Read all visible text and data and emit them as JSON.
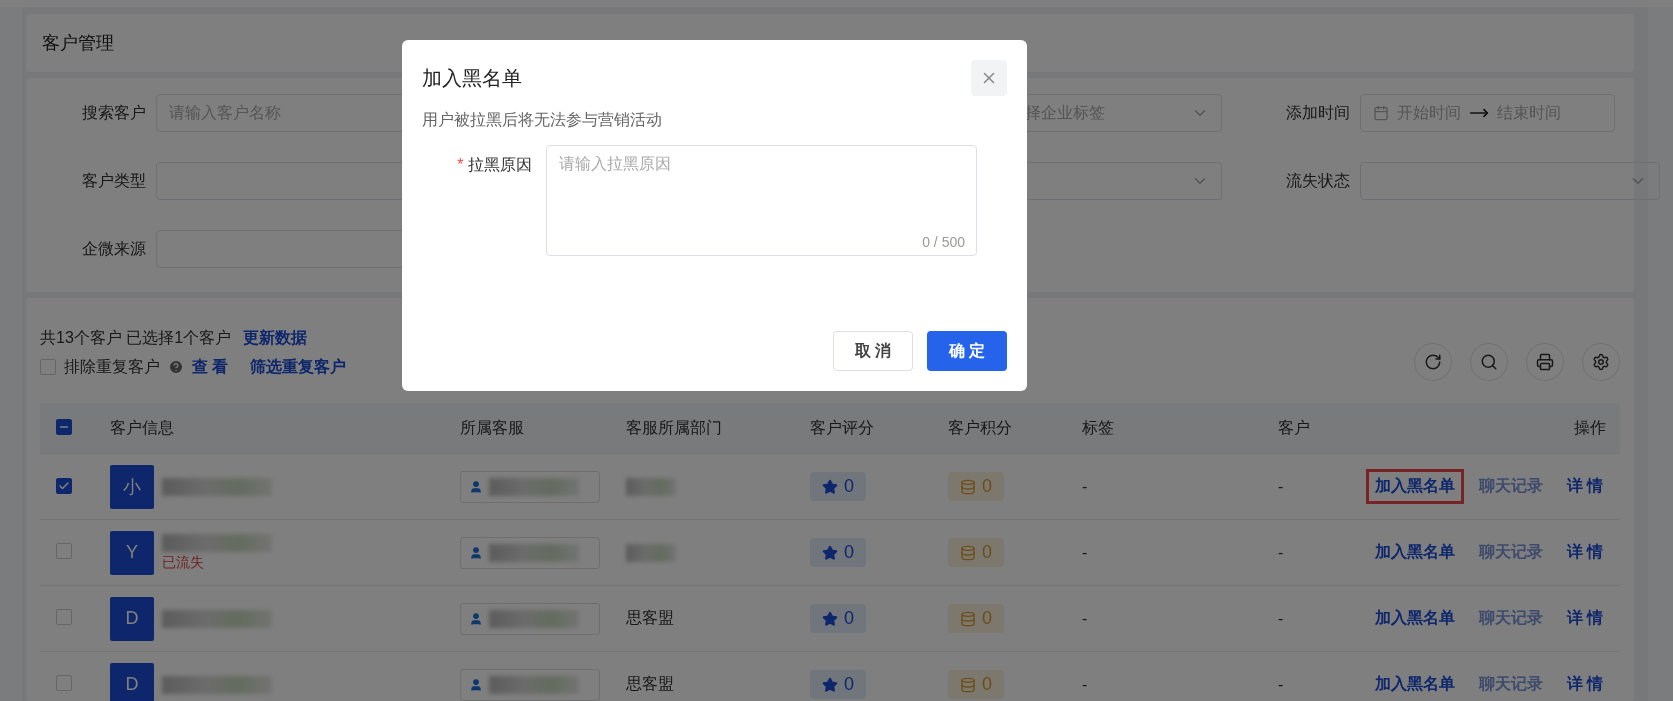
{
  "page_title": "客户管理",
  "filters": [
    {
      "label": "搜索客户",
      "kind": "input",
      "placeholder": "请输入客户名称"
    },
    {
      "kind": "select",
      "placeholder": "择企业标签"
    },
    {
      "label": "添加时间",
      "kind": "daterange",
      "start_placeholder": "开始时间",
      "end_placeholder": "结束时间"
    },
    {
      "label": "客户类型",
      "kind": "select"
    },
    {
      "kind": "select"
    },
    {
      "label": "流失状态",
      "kind": "select"
    },
    {
      "label": "企微来源",
      "kind": "select"
    }
  ],
  "summary": {
    "text": "共13个客户 已选择1个客户",
    "refresh_link": "更新数据",
    "exclude_label": "排除重复客户",
    "exclude_checked": false,
    "view_link": "查 看",
    "filter_link": "筛选重复客户"
  },
  "table": {
    "header_indeterminate": true,
    "columns": [
      "客户信息",
      "所属客服",
      "客服所属部门",
      "客户评分",
      "客户积分",
      "标签",
      "客户",
      "操作"
    ],
    "rows": [
      {
        "checked": true,
        "avatar": "小",
        "department": null,
        "rating": "0",
        "points": "0",
        "tags": "-",
        "column_7": "-",
        "actions": [
          {
            "label": "加入黑名单",
            "disabled": false,
            "highlighted": true
          },
          {
            "label": "聊天记录",
            "disabled": true,
            "highlighted": false
          },
          {
            "label": "详 情",
            "disabled": false,
            "highlighted": false
          }
        ]
      },
      {
        "checked": false,
        "avatar": "Y",
        "status_tag": "已流失",
        "department": null,
        "rating": "0",
        "points": "0",
        "tags": "-",
        "column_7": "-",
        "actions": [
          {
            "label": "加入黑名单",
            "disabled": false,
            "highlighted": false
          },
          {
            "label": "聊天记录",
            "disabled": true,
            "highlighted": false
          },
          {
            "label": "详 情",
            "disabled": false,
            "highlighted": false
          }
        ]
      },
      {
        "checked": false,
        "avatar": "D",
        "department": "思客盟",
        "rating": "0",
        "points": "0",
        "tags": "-",
        "column_7": "-",
        "actions": [
          {
            "label": "加入黑名单",
            "disabled": false,
            "highlighted": false
          },
          {
            "label": "聊天记录",
            "disabled": true,
            "highlighted": false
          },
          {
            "label": "详 情",
            "disabled": false,
            "highlighted": false
          }
        ]
      },
      {
        "checked": false,
        "avatar": "D",
        "department": "思客盟",
        "rating": "0",
        "points": "0",
        "tags": "-",
        "column_7": "-",
        "actions": [
          {
            "label": "加入黑名单",
            "disabled": false,
            "highlighted": false
          },
          {
            "label": "聊天记录",
            "disabled": true,
            "highlighted": false
          },
          {
            "label": "详 情",
            "disabled": false,
            "highlighted": false
          }
        ]
      }
    ]
  },
  "dialog": {
    "title": "加入黑名单",
    "description": "用户被拉黑后将无法参与营销活动",
    "field_label": "拉黑原因",
    "required_mark": "*",
    "placeholder": "请输入拉黑原因",
    "counter": "0 / 500",
    "cancel": "取 消",
    "confirm": "确 定"
  }
}
